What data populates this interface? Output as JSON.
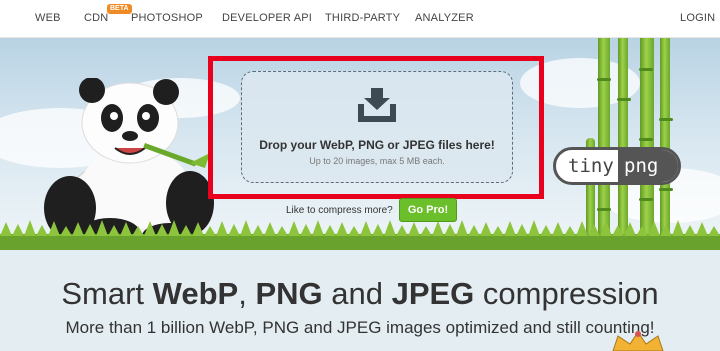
{
  "nav": {
    "items": [
      "WEB",
      "CDN",
      "PHOTOSHOP",
      "DEVELOPER API",
      "THIRD-PARTY",
      "ANALYZER"
    ],
    "cdn_badge": "BETA",
    "login": "LOGIN"
  },
  "upload": {
    "title": "Drop your WebP, PNG or JPEG files here!",
    "subtitle": "Up to 20 images, max 5 MB each.",
    "icon": "download-tray-icon"
  },
  "logo": {
    "part1": "tiny",
    "part2": "png"
  },
  "promo": {
    "text": "Like to compress more?",
    "button": "Go Pro!"
  },
  "headline": {
    "part1": "Smart ",
    "bold1": "WebP",
    "part2": ", ",
    "bold2": "PNG",
    "part3": " and ",
    "bold3": "JPEG",
    "part4": " compression"
  },
  "subline": "More than 1 billion WebP, PNG and JPEG images optimized and still counting!",
  "colors": {
    "highlight": "#e8001c",
    "button": "#6bbf2b",
    "badge": "#f08a24"
  }
}
